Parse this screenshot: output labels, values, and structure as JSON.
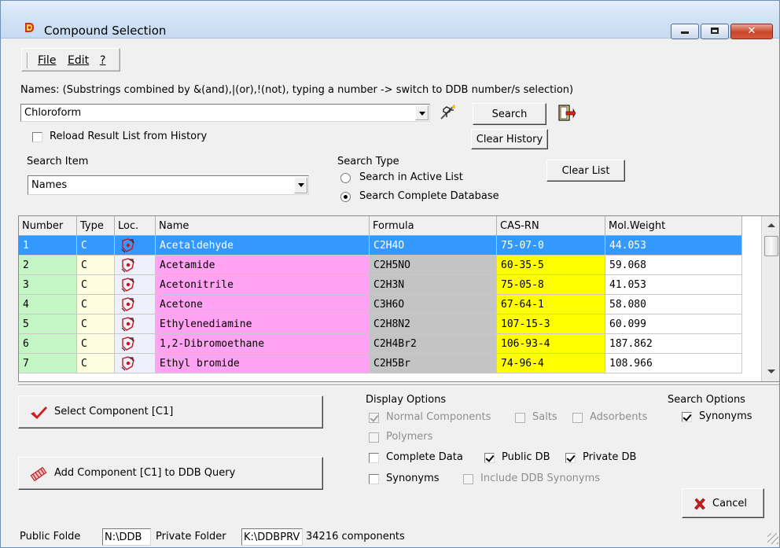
{
  "window": {
    "title": "Compound Selection",
    "close_glyph": "✕"
  },
  "menu": {
    "file": "File",
    "edit": "Edit",
    "help": "?"
  },
  "names_label": "Names: (Substrings combined by &(and),|(or),!(not), typing a number -> switch to DDB number/s selection)",
  "search_input": {
    "value": "Chloroform"
  },
  "reload_history": {
    "label": "Reload Result List from History",
    "checked": false
  },
  "buttons": {
    "search": "Search",
    "clear_history": "Clear History",
    "clear_list": "Clear List",
    "select_component": "Select Component [C1]",
    "add_component": "Add Component [C1] to DDB Query",
    "cancel": "Cancel"
  },
  "search_item": {
    "label": "Search Item",
    "value": "Names"
  },
  "search_type": {
    "label": "Search Type",
    "options": [
      "Search in  Active List",
      "Search Complete Database"
    ],
    "selected": 1
  },
  "table": {
    "columns": [
      "Number",
      "Type",
      "Loc.",
      "Name",
      "Formula",
      "CAS-RN",
      "Mol.Weight"
    ],
    "rows": [
      [
        "1",
        "C",
        "",
        "Acetaldehyde",
        "C2H4O",
        "75-07-0",
        "44.053"
      ],
      [
        "2",
        "C",
        "",
        "Acetamide",
        "C2H5NO",
        "60-35-5",
        "59.068"
      ],
      [
        "3",
        "C",
        "",
        "Acetonitrile",
        "C2H3N",
        "75-05-8",
        "41.053"
      ],
      [
        "4",
        "C",
        "",
        "Acetone",
        "C3H6O",
        "67-64-1",
        "58.080"
      ],
      [
        "5",
        "C",
        "",
        "Ethylenediamine",
        "C2H8N2",
        "107-15-3",
        "60.099"
      ],
      [
        "6",
        "C",
        "",
        "1,2-Dibromoethane",
        "C2H4Br2",
        "106-93-4",
        "187.862"
      ],
      [
        "7",
        "C",
        "",
        "Ethyl bromide",
        "C2H5Br",
        "74-96-4",
        "108.966"
      ]
    ],
    "selected_row": 0,
    "colors": {
      "selected": "#3399ff",
      "number": "#c4f5c4",
      "type": "#fffde0",
      "loc": "#eef0fc",
      "name": "#ffa3f2",
      "formula": "#c4c4c4",
      "cas": "#ffff00",
      "weight": "#ffffff"
    }
  },
  "display_options": {
    "label": "Display Options",
    "normal_components": {
      "label": "Normal Components",
      "checked": true,
      "disabled": true
    },
    "salts": {
      "label": "Salts",
      "checked": false,
      "disabled": true
    },
    "adsorbents": {
      "label": "Adsorbents",
      "checked": false,
      "disabled": true
    },
    "polymers": {
      "label": "Polymers",
      "checked": false,
      "disabled": true
    },
    "complete_data": {
      "label": "Complete Data",
      "checked": false
    },
    "public_db": {
      "label": "Public DB",
      "checked": true
    },
    "private_db": {
      "label": "Private DB",
      "checked": true
    },
    "synonyms": {
      "label": "Synonyms",
      "checked": false
    },
    "include_ddb_synonyms": {
      "label": "Include DDB Synonyms",
      "checked": false,
      "disabled": true
    }
  },
  "search_options": {
    "label": "Search Options",
    "synonyms": {
      "label": "Synonyms",
      "checked": true
    }
  },
  "status": {
    "public_label": "Public Folde",
    "public_value": "N:\\DDB",
    "private_label": "Private Folder",
    "private_value": "K:\\DDBPRV",
    "count": "34216 components"
  },
  "icons": {
    "app": "app-logo-icon",
    "structure": "molecule-editor-icon",
    "exit": "exit-door-icon",
    "select": "checkmark-icon",
    "add": "add-query-icon",
    "cancel": "red-x-icon",
    "loc": "location-move-icon"
  }
}
